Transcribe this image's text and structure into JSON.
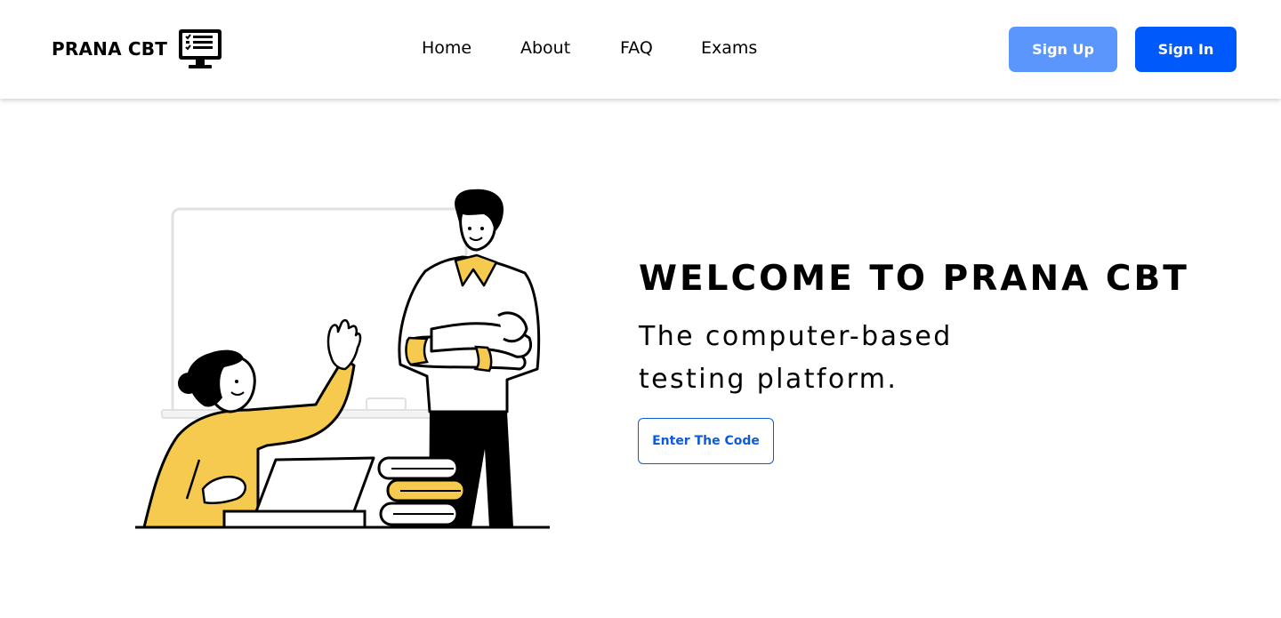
{
  "brand": {
    "name": "PRANA CBT",
    "logo_icon": "computer-test-icon"
  },
  "nav": {
    "items": [
      {
        "label": "Home"
      },
      {
        "label": "About"
      },
      {
        "label": "FAQ"
      },
      {
        "label": "Exams"
      }
    ]
  },
  "auth": {
    "signup_label": "Sign Up",
    "signin_label": "Sign In"
  },
  "hero": {
    "title": "WELCOME TO PRANA CBT",
    "subtitle": "The computer-based testing platform.",
    "cta_label": "Enter The Code",
    "illustration": "teacher-and-student-illustration"
  },
  "colors": {
    "primary": "#0059fa",
    "primary_light": "#5b96fc",
    "cta_border": "#0b5bdc",
    "illustration_yellow": "#f6c94f",
    "text": "#000000",
    "background": "#ffffff"
  }
}
